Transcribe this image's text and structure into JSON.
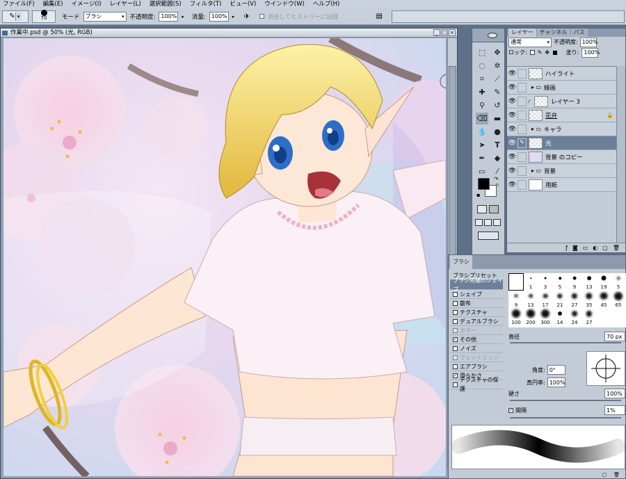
{
  "menu": [
    "ファイル(F)",
    "編集(E)",
    "イメージ(I)",
    "レイヤー(L)",
    "選択範囲(S)",
    "フィルタ(T)",
    "ビュー(V)",
    "ウインドウ(W)",
    "ヘルプ(H)"
  ],
  "options": {
    "brush_size": "70",
    "mode_label": "モード",
    "mode_value": "ブラシ",
    "opacity_label": "不透明度:",
    "opacity_value": "100%",
    "flow_label": "流量:",
    "flow_value": "100%",
    "history_label": "消去してヒストリーに記録"
  },
  "document": {
    "title": "作業中.psd @ 50% (光, RGB)"
  },
  "layers": {
    "tabs": [
      "レイヤー",
      "チャンネル",
      "パス"
    ],
    "blend_mode": "通常",
    "opacity_label": "不透明度:",
    "opacity_value": "100%",
    "lock_label": "ロック:",
    "fill_label": "塗り:",
    "fill_value": "100%",
    "items": [
      {
        "name": "ハイライト",
        "type": "layer",
        "selected": false
      },
      {
        "name": "線画",
        "type": "folder",
        "selected": false
      },
      {
        "name": "レイヤー 3",
        "type": "layer",
        "selected": false
      },
      {
        "name": "花弁",
        "type": "layer",
        "selected": false
      },
      {
        "name": "キャラ",
        "type": "folder",
        "selected": false
      },
      {
        "name": "光",
        "type": "layer",
        "selected": true
      },
      {
        "name": "背景 のコピー",
        "type": "layer",
        "selected": false
      },
      {
        "name": "背景",
        "type": "folder",
        "selected": false
      },
      {
        "name": "用紙",
        "type": "layer",
        "selected": false
      }
    ]
  },
  "brush_panel": {
    "title": "ブラシ",
    "presets_label": "ブラシプリセット",
    "tip_shape_label": "ブラシ先端のシェイプ",
    "options": [
      {
        "label": "シェイプ",
        "checked": false,
        "disabled": false
      },
      {
        "label": "散布",
        "checked": false,
        "disabled": false
      },
      {
        "label": "テクスチャ",
        "checked": false,
        "disabled": false
      },
      {
        "label": "デュアルブラシ",
        "checked": false,
        "disabled": false
      },
      {
        "label": "カラー",
        "checked": false,
        "disabled": true
      },
      {
        "label": "その他",
        "checked": true,
        "disabled": false
      },
      {
        "label": "ノイズ",
        "checked": false,
        "disabled": false
      },
      {
        "label": "ウェットエッジ",
        "checked": false,
        "disabled": true
      },
      {
        "label": "エアブラシ",
        "checked": false,
        "disabled": false
      },
      {
        "label": "滑らかさ",
        "checked": true,
        "disabled": false
      },
      {
        "label": "テクスチャの保護",
        "checked": false,
        "disabled": false
      }
    ],
    "tips": [
      "1",
      "3",
      "5",
      "9",
      "13",
      "19",
      "5",
      "9",
      "13",
      "17",
      "21",
      "27",
      "35",
      "45",
      "65",
      "100",
      "200",
      "300",
      "14",
      "24",
      "27"
    ],
    "diameter_label": "直径",
    "diameter_value": "70 px",
    "angle_label": "角度:",
    "angle_value": "0°",
    "roundness_label": "真円率:",
    "roundness_value": "100%",
    "hardness_label": "硬さ",
    "hardness_value": "100%",
    "spacing_label": "間隔",
    "spacing_value": "1%"
  }
}
